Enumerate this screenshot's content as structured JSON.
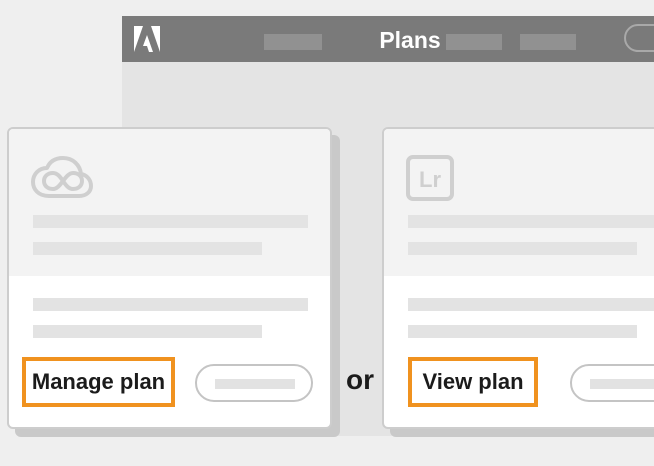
{
  "window": {
    "title": "Plans"
  },
  "cards": [
    {
      "icon": "creative-cloud-icon",
      "action_label": "Manage plan"
    },
    {
      "icon": "lightroom-icon",
      "icon_text": "Lr",
      "action_label": "View plan"
    }
  ],
  "separator": {
    "text": "or"
  },
  "colors": {
    "highlight": "#f0921f",
    "titlebar": "#7a7a7a",
    "window_body": "#e4e4e4",
    "card": "#ffffff"
  }
}
